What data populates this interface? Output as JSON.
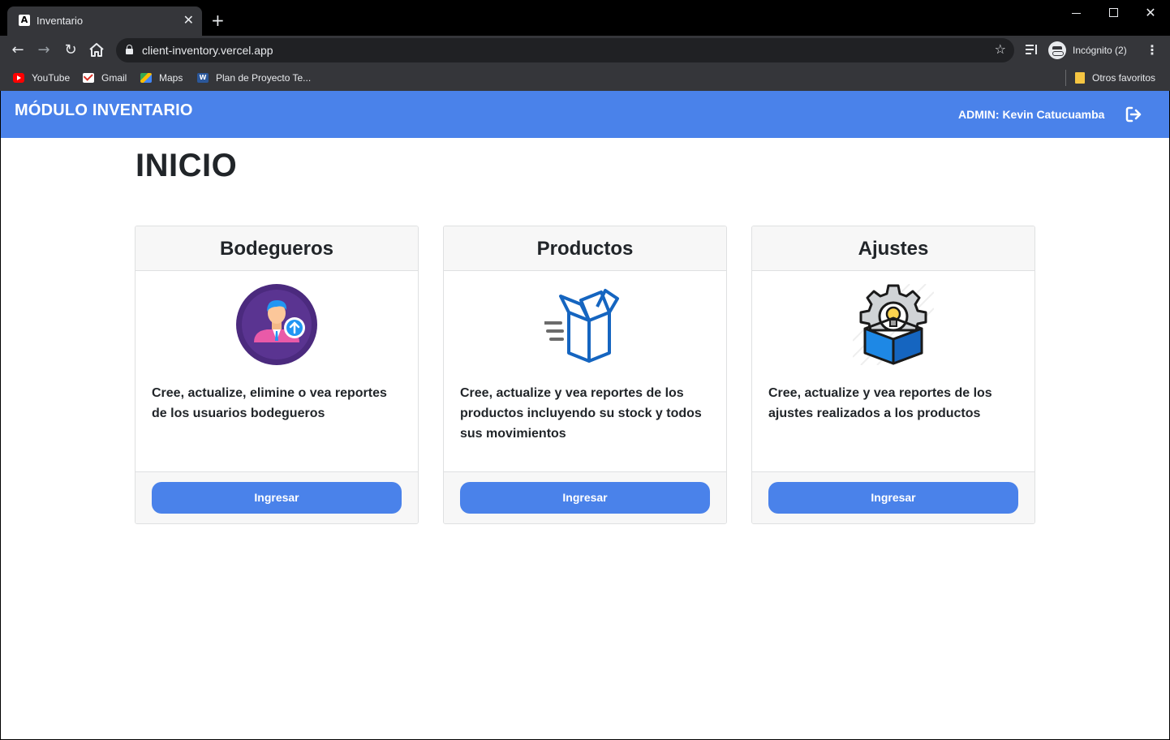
{
  "browser": {
    "tab_title": "Inventario",
    "tab_favicon": "A",
    "url": "client-inventory.vercel.app",
    "profile_label": "Incógnito (2)",
    "bookmarks": [
      {
        "label": "YouTube",
        "icon": "youtube-icon"
      },
      {
        "label": "Gmail",
        "icon": "gmail-icon"
      },
      {
        "label": "Maps",
        "icon": "maps-icon"
      },
      {
        "label": "Plan de Proyecto Te...",
        "icon": "word-icon"
      }
    ],
    "other_bookmarks": "Otros favoritos"
  },
  "app": {
    "title": "MÓDULO INVENTARIO",
    "user_role": "ADMIN:",
    "user_name": "Kevin Catucuamba",
    "accent_color": "#4a82ea"
  },
  "main": {
    "page_title": "INICIO",
    "cards": [
      {
        "title": "Bodegueros",
        "icon": "user-upload-icon",
        "description": "Cree, actualize, elimine o vea reportes de los usuarios bodegueros",
        "button_label": "Ingresar"
      },
      {
        "title": "Productos",
        "icon": "open-box-icon",
        "description": "Cree, actualize y vea reportes de los productos incluyendo su stock y todos sus movimientos",
        "button_label": "Ingresar"
      },
      {
        "title": "Ajustes",
        "icon": "gear-box-icon",
        "description": "Cree, actualize y vea reportes de los ajustes realizados a los productos",
        "button_label": "Ingresar"
      }
    ]
  }
}
